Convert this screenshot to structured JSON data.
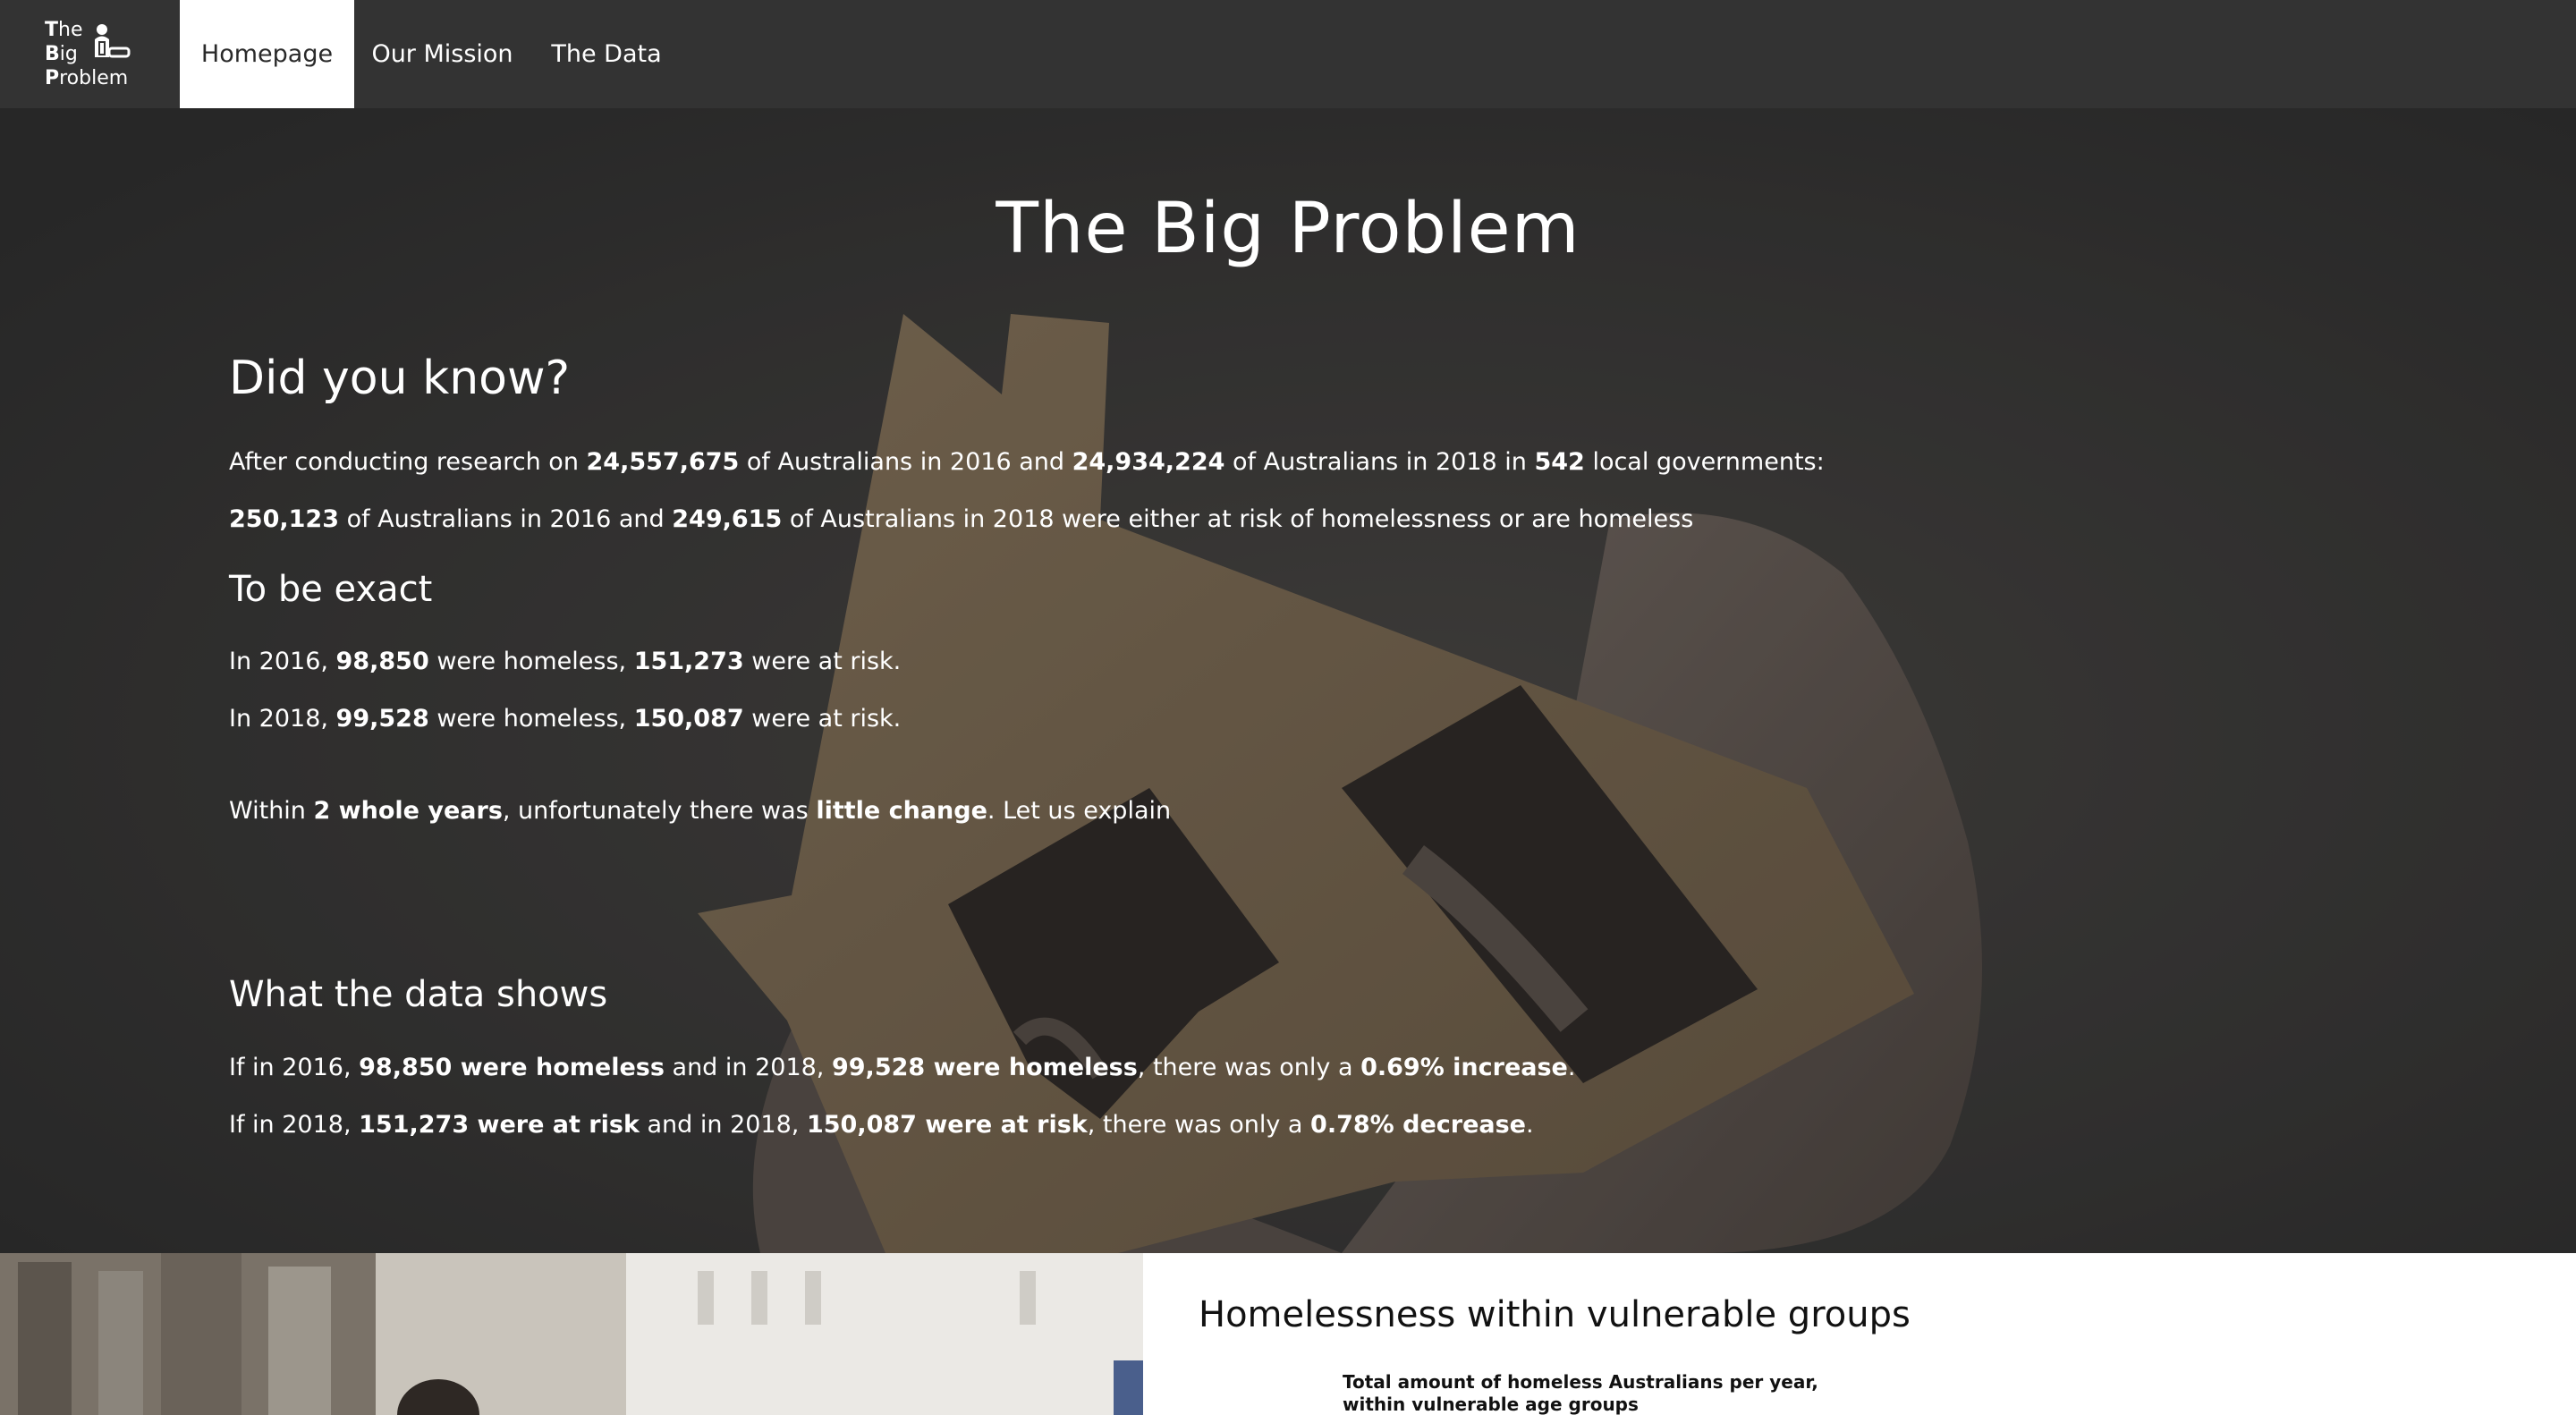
{
  "nav": {
    "logo": {
      "line1": "The",
      "line2": "Big",
      "line3": "Problem"
    },
    "items": [
      {
        "label": "Homepage",
        "active": true
      },
      {
        "label": "Our Mission",
        "active": false
      },
      {
        "label": "The Data",
        "active": false
      }
    ]
  },
  "hero": {
    "title": "The Big Problem",
    "did_you_know": "Did you know?",
    "research": {
      "p1_a": "After conducting research on ",
      "p1_b": "24,557,675",
      "p1_c": " of Australians in 2016 and ",
      "p1_d": "24,934,224",
      "p1_e": " of Australians in 2018 in ",
      "p1_f": "542",
      "p1_g": " local governments:",
      "p2_a": "250,123",
      "p2_b": " of Australians in 2016 and ",
      "p2_c": "249,615",
      "p2_d": " of Australians in 2018 were either at risk of homelessness or are homeless"
    },
    "to_be_exact": "To be exact",
    "exact": {
      "r2016_a": "In 2016, ",
      "r2016_b": "98,850",
      "r2016_c": " were homeless, ",
      "r2016_d": "151,273",
      "r2016_e": " were at risk.",
      "r2018_a": "In 2018, ",
      "r2018_b": "99,528",
      "r2018_c": " were homeless, ",
      "r2018_d": "150,087",
      "r2018_e": " were at risk."
    },
    "within": {
      "a": "Within ",
      "b": "2 whole years",
      "c": ", unfortunately there was ",
      "d": "little change",
      "e": ". Let us explain"
    },
    "what_data_shows": "What the data shows",
    "shows": {
      "l1_a": "If in 2016, ",
      "l1_b": "98,850 were homeless",
      "l1_c": " and in 2018, ",
      "l1_d": "99,528 were homeless",
      "l1_e": ", there was only a ",
      "l1_f": "0.69% increase",
      "l1_g": ".",
      "l2_a": "If in 2018, ",
      "l2_b": "151,273 were at risk",
      "l2_c": " and in 2018, ",
      "l2_d": "150,087 were at risk",
      "l2_e": ", there was only a ",
      "l2_f": "0.78% decrease",
      "l2_g": "."
    }
  },
  "bottom": {
    "section_title": "Homelessness within vulnerable groups",
    "chart_title": "Total amount of homeless Australians per year, within vulnerable age groups"
  },
  "colors": {
    "navbar": "#333333",
    "nav_active_bg": "#ffffff",
    "hero_text": "#ffffff",
    "cardboard": "#9a8466"
  }
}
